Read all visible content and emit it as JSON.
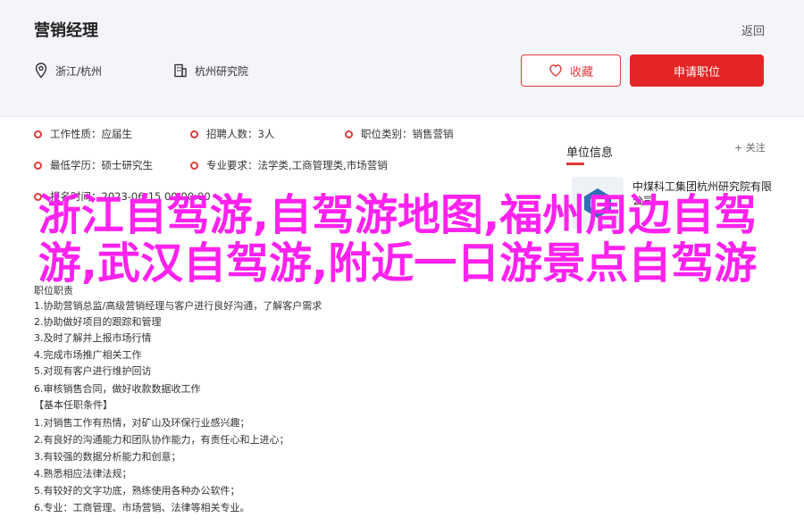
{
  "job": {
    "title": "营销经理",
    "back_label": "返回",
    "location": "浙江/杭州",
    "company_short": "杭州研究院",
    "favorite_label": "收藏",
    "apply_label": "申请职位"
  },
  "info": [
    {
      "label": "工作性质：",
      "value": "应届生"
    },
    {
      "label": "招聘人数：",
      "value": "3人"
    },
    {
      "label": "职位类别：",
      "value": "销售营销"
    },
    {
      "label": "最低学历：",
      "value": "硕士研究生"
    },
    {
      "label": "专业要求：",
      "value": "法学类,工商管理类,市场营销"
    },
    {
      "label": "报名时间：",
      "value": "2023-06-15 00:00:00"
    }
  ],
  "unit": {
    "title": "单位信息",
    "follow_label": "+ 关注",
    "company_name": "中煤科工集团杭州研究院有限公司"
  },
  "description": {
    "duty_header": "职位职责",
    "duties": [
      "1.协助营销总监/高级营销经理与客户进行良好沟通，了解客户需求",
      "2.协助做好项目的跟踪和管理",
      "3.及时了解并上报市场行情",
      "4.完成市场推广相关工作",
      "5.对现有客户进行维护回访",
      "6.审核销售合同，做好收款数据收工作"
    ],
    "req_header": "【基本任职条件】",
    "requirements": [
      "1.对销售工作有热情，对矿山及环保行业感兴趣；",
      "2.有良好的沟通能力和团队协作能力，有责任心和上进心；",
      "3.有较强的数据分析能力和创意；",
      "4.熟悉相应法律法规；",
      "5.有较好的文字功底，熟练使用各种办公软件；",
      "6.专业：工商管理、市场营销、法律等相关专业。"
    ]
  },
  "overlay": {
    "headline": "浙江自驾游,自驾游地图,福州周边自驾游,武汉自驾游,附近一日游景点自驾游"
  },
  "colors": {
    "accent": "#e33a3a",
    "overlay": "#ff22ee",
    "header_bg": "#f3f5f9"
  }
}
